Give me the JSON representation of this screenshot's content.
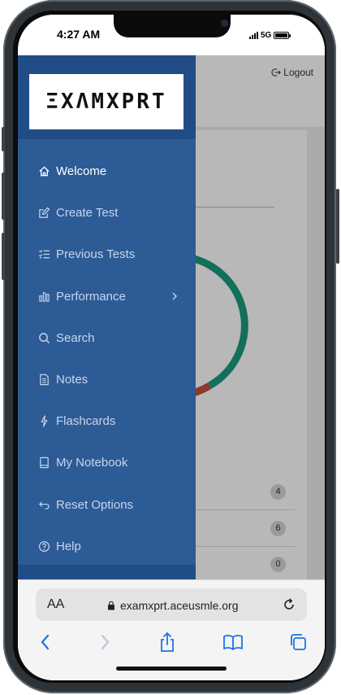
{
  "status_bar": {
    "time": "4:27 AM",
    "network": "5G"
  },
  "page": {
    "logout_label": "Logout",
    "badges": [
      "4",
      "6",
      "0"
    ]
  },
  "sidebar": {
    "logo": "ΞXΛMXPRT",
    "items": [
      {
        "label": "Welcome",
        "icon": "home-icon",
        "active": true
      },
      {
        "label": "Create Test",
        "icon": "edit-icon"
      },
      {
        "label": "Previous Tests",
        "icon": "list-check-icon"
      },
      {
        "label": "Performance",
        "icon": "bar-chart-icon",
        "has_submenu": true
      },
      {
        "label": "Search",
        "icon": "search-icon"
      },
      {
        "label": "Notes",
        "icon": "document-icon"
      },
      {
        "label": "Flashcards",
        "icon": "lightning-icon"
      },
      {
        "label": "My Notebook",
        "icon": "notebook-icon"
      },
      {
        "label": "Reset Options",
        "icon": "undo-icon"
      },
      {
        "label": "Help",
        "icon": "help-icon"
      }
    ]
  },
  "browser": {
    "text_size_label": "AA",
    "url": "examxprt.aceusmle.org"
  },
  "colors": {
    "sidebar": "#2d5b96",
    "sidebar_header": "#214d86",
    "donut_green": "#1a9a80",
    "donut_red": "#c4503e",
    "ios_blue": "#1a73e8"
  }
}
